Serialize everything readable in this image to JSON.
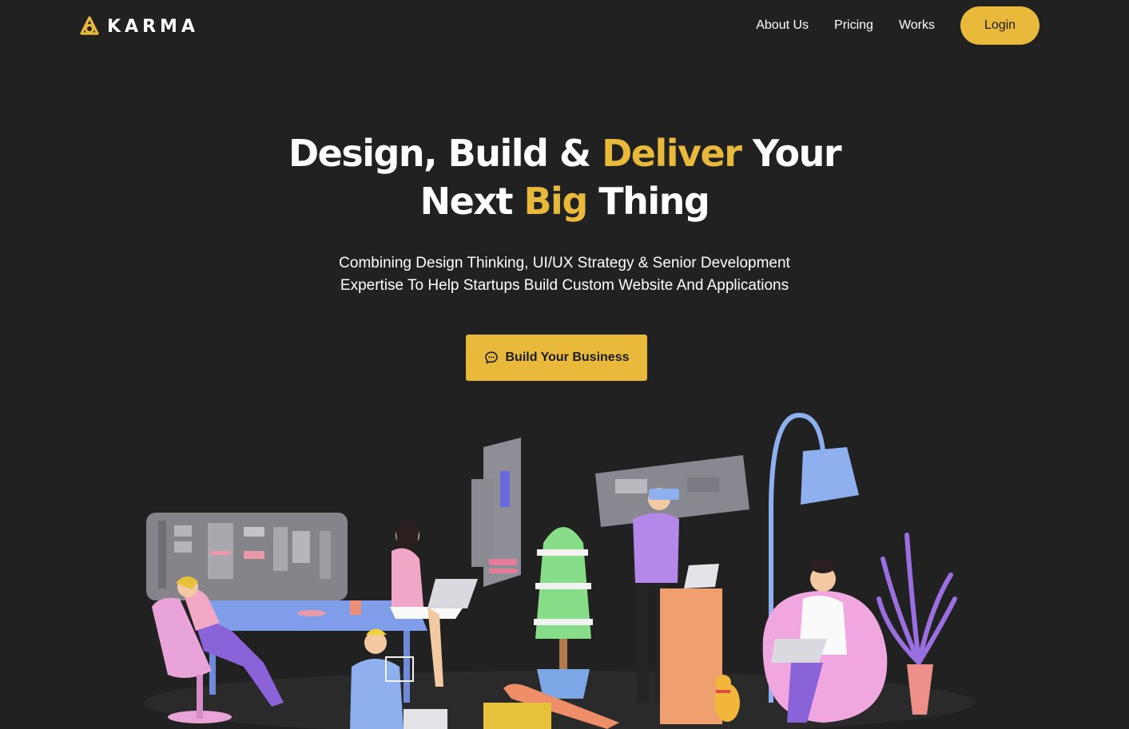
{
  "brand": {
    "name": "KARMA",
    "accent_color": "#e8b93a",
    "background_color": "#212121"
  },
  "nav": {
    "links": [
      "About Us",
      "Pricing",
      "Works"
    ],
    "login_label": "Login"
  },
  "hero": {
    "title_part1": "Design, Build & ",
    "title_accent1": "Deliver",
    "title_part2": " Your",
    "title_part3": "Next ",
    "title_accent2": "Big",
    "title_part4": " Thing",
    "subtitle_line1": "Combining Design Thinking, UI/UX Strategy & Senior Development",
    "subtitle_line2": "Expertise To Help Startups Build Custom Website And Applications",
    "cta_label": "Build Your Business",
    "cta_icon": "chat-bubble-icon"
  },
  "illustration": {
    "icon": "office-team-illustration"
  }
}
